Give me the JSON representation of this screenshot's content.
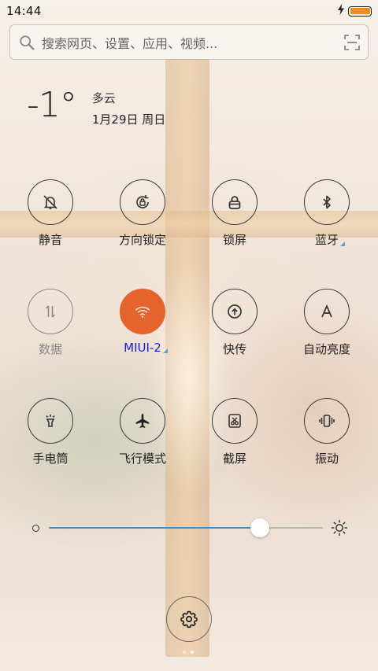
{
  "status_bar": {
    "time": "14:44",
    "battery_color": "#f28c1e",
    "charging_icon": "bolt-icon"
  },
  "search": {
    "placeholder": "搜索网页、设置、应用、视频...",
    "icon": "search-icon",
    "scan_icon": "scan-icon"
  },
  "weather": {
    "temperature": "-1°",
    "condition": "多云",
    "date": "1月29日 周日"
  },
  "toggles": [
    {
      "label": "静音",
      "icon": "mute-bell-icon",
      "state": "off"
    },
    {
      "label": "方向锁定",
      "icon": "rotation-lock-icon",
      "state": "off"
    },
    {
      "label": "锁屏",
      "icon": "lock-icon",
      "state": "off"
    },
    {
      "label": "蓝牙",
      "icon": "bluetooth-icon",
      "state": "off",
      "has_more": true
    },
    {
      "label": "数据",
      "icon": "mobile-data-icon",
      "state": "disabled"
    },
    {
      "label": "MIUI-2",
      "icon": "wifi-icon",
      "state": "on",
      "has_more": true
    },
    {
      "label": "快传",
      "icon": "quick-transfer-icon",
      "state": "off"
    },
    {
      "label": "自动亮度",
      "icon": "auto-brightness-icon",
      "state": "off"
    },
    {
      "label": "手电筒",
      "icon": "flashlight-icon",
      "state": "off"
    },
    {
      "label": "飞行模式",
      "icon": "airplane-icon",
      "state": "off"
    },
    {
      "label": "截屏",
      "icon": "screenshot-icon",
      "state": "off"
    },
    {
      "label": "振动",
      "icon": "vibrate-icon",
      "state": "off"
    }
  ],
  "brightness": {
    "level": 0.77,
    "accent_color": "#3d8fd6"
  },
  "active_color": "#e7632d",
  "settings": {
    "icon": "gear-icon"
  },
  "pager": {
    "pages": 2,
    "current": 2
  }
}
